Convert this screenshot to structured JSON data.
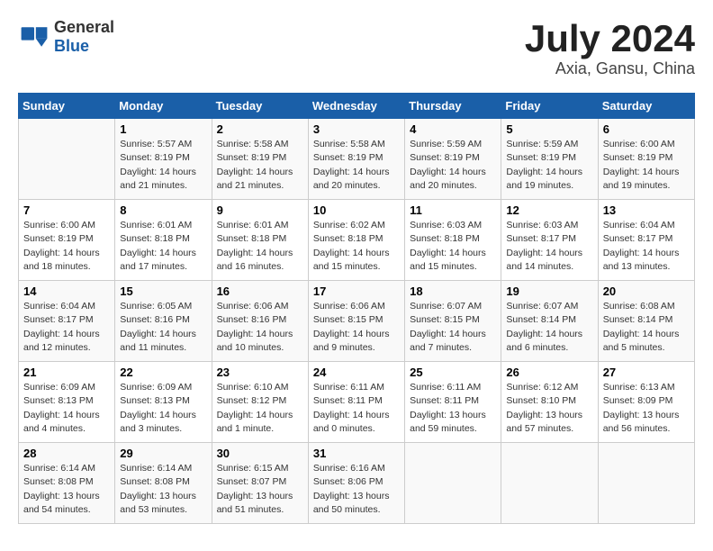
{
  "header": {
    "logo_general": "General",
    "logo_blue": "Blue",
    "title": "July 2024",
    "location": "Axia, Gansu, China"
  },
  "columns": [
    "Sunday",
    "Monday",
    "Tuesday",
    "Wednesday",
    "Thursday",
    "Friday",
    "Saturday"
  ],
  "weeks": [
    [
      {
        "day": "",
        "info": ""
      },
      {
        "day": "1",
        "info": "Sunrise: 5:57 AM\nSunset: 8:19 PM\nDaylight: 14 hours\nand 21 minutes."
      },
      {
        "day": "2",
        "info": "Sunrise: 5:58 AM\nSunset: 8:19 PM\nDaylight: 14 hours\nand 21 minutes."
      },
      {
        "day": "3",
        "info": "Sunrise: 5:58 AM\nSunset: 8:19 PM\nDaylight: 14 hours\nand 20 minutes."
      },
      {
        "day": "4",
        "info": "Sunrise: 5:59 AM\nSunset: 8:19 PM\nDaylight: 14 hours\nand 20 minutes."
      },
      {
        "day": "5",
        "info": "Sunrise: 5:59 AM\nSunset: 8:19 PM\nDaylight: 14 hours\nand 19 minutes."
      },
      {
        "day": "6",
        "info": "Sunrise: 6:00 AM\nSunset: 8:19 PM\nDaylight: 14 hours\nand 19 minutes."
      }
    ],
    [
      {
        "day": "7",
        "info": "Sunrise: 6:00 AM\nSunset: 8:19 PM\nDaylight: 14 hours\nand 18 minutes."
      },
      {
        "day": "8",
        "info": "Sunrise: 6:01 AM\nSunset: 8:18 PM\nDaylight: 14 hours\nand 17 minutes."
      },
      {
        "day": "9",
        "info": "Sunrise: 6:01 AM\nSunset: 8:18 PM\nDaylight: 14 hours\nand 16 minutes."
      },
      {
        "day": "10",
        "info": "Sunrise: 6:02 AM\nSunset: 8:18 PM\nDaylight: 14 hours\nand 15 minutes."
      },
      {
        "day": "11",
        "info": "Sunrise: 6:03 AM\nSunset: 8:18 PM\nDaylight: 14 hours\nand 15 minutes."
      },
      {
        "day": "12",
        "info": "Sunrise: 6:03 AM\nSunset: 8:17 PM\nDaylight: 14 hours\nand 14 minutes."
      },
      {
        "day": "13",
        "info": "Sunrise: 6:04 AM\nSunset: 8:17 PM\nDaylight: 14 hours\nand 13 minutes."
      }
    ],
    [
      {
        "day": "14",
        "info": "Sunrise: 6:04 AM\nSunset: 8:17 PM\nDaylight: 14 hours\nand 12 minutes."
      },
      {
        "day": "15",
        "info": "Sunrise: 6:05 AM\nSunset: 8:16 PM\nDaylight: 14 hours\nand 11 minutes."
      },
      {
        "day": "16",
        "info": "Sunrise: 6:06 AM\nSunset: 8:16 PM\nDaylight: 14 hours\nand 10 minutes."
      },
      {
        "day": "17",
        "info": "Sunrise: 6:06 AM\nSunset: 8:15 PM\nDaylight: 14 hours\nand 9 minutes."
      },
      {
        "day": "18",
        "info": "Sunrise: 6:07 AM\nSunset: 8:15 PM\nDaylight: 14 hours\nand 7 minutes."
      },
      {
        "day": "19",
        "info": "Sunrise: 6:07 AM\nSunset: 8:14 PM\nDaylight: 14 hours\nand 6 minutes."
      },
      {
        "day": "20",
        "info": "Sunrise: 6:08 AM\nSunset: 8:14 PM\nDaylight: 14 hours\nand 5 minutes."
      }
    ],
    [
      {
        "day": "21",
        "info": "Sunrise: 6:09 AM\nSunset: 8:13 PM\nDaylight: 14 hours\nand 4 minutes."
      },
      {
        "day": "22",
        "info": "Sunrise: 6:09 AM\nSunset: 8:13 PM\nDaylight: 14 hours\nand 3 minutes."
      },
      {
        "day": "23",
        "info": "Sunrise: 6:10 AM\nSunset: 8:12 PM\nDaylight: 14 hours\nand 1 minute."
      },
      {
        "day": "24",
        "info": "Sunrise: 6:11 AM\nSunset: 8:11 PM\nDaylight: 14 hours\nand 0 minutes."
      },
      {
        "day": "25",
        "info": "Sunrise: 6:11 AM\nSunset: 8:11 PM\nDaylight: 13 hours\nand 59 minutes."
      },
      {
        "day": "26",
        "info": "Sunrise: 6:12 AM\nSunset: 8:10 PM\nDaylight: 13 hours\nand 57 minutes."
      },
      {
        "day": "27",
        "info": "Sunrise: 6:13 AM\nSunset: 8:09 PM\nDaylight: 13 hours\nand 56 minutes."
      }
    ],
    [
      {
        "day": "28",
        "info": "Sunrise: 6:14 AM\nSunset: 8:08 PM\nDaylight: 13 hours\nand 54 minutes."
      },
      {
        "day": "29",
        "info": "Sunrise: 6:14 AM\nSunset: 8:08 PM\nDaylight: 13 hours\nand 53 minutes."
      },
      {
        "day": "30",
        "info": "Sunrise: 6:15 AM\nSunset: 8:07 PM\nDaylight: 13 hours\nand 51 minutes."
      },
      {
        "day": "31",
        "info": "Sunrise: 6:16 AM\nSunset: 8:06 PM\nDaylight: 13 hours\nand 50 minutes."
      },
      {
        "day": "",
        "info": ""
      },
      {
        "day": "",
        "info": ""
      },
      {
        "day": "",
        "info": ""
      }
    ]
  ]
}
